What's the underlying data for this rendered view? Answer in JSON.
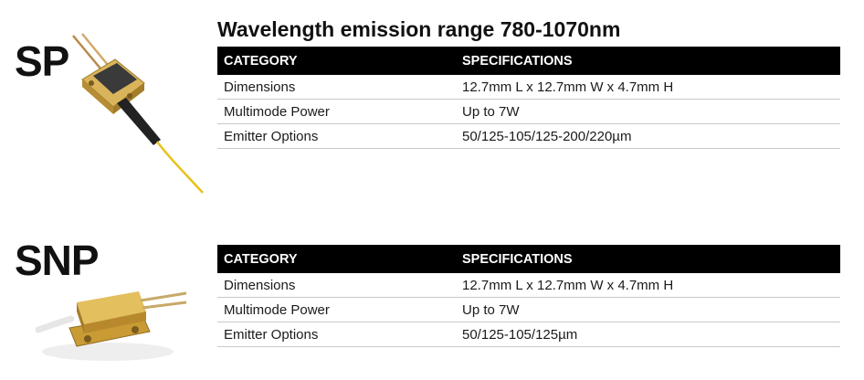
{
  "products": [
    {
      "label": "SP",
      "header": {
        "col1": "CATEGORY",
        "col2": "SPECIFICATIONS"
      },
      "rows": [
        {
          "category": "Dimensions",
          "spec": "12.7mm L x 12.7mm W x 4.7mm H"
        },
        {
          "category": "Multimode Power",
          "spec": "Up to 7W"
        },
        {
          "category": "Emitter Options",
          "spec": "50/125-105/125-200/220µm"
        }
      ]
    },
    {
      "label": "SNP",
      "header": {
        "col1": "CATEGORY",
        "col2": "SPECIFICATIONS"
      },
      "rows": [
        {
          "category": "Dimensions",
          "spec": "12.7mm L x 12.7mm W x 4.7mm H"
        },
        {
          "category": "Multimode Power",
          "spec": "Up to 7W"
        },
        {
          "category": "Emitter Options",
          "spec": "50/125-105/125µm"
        }
      ]
    }
  ],
  "section_title": "Wavelength emission range 780-1070nm",
  "colors": {
    "header_bg": "#000000",
    "header_text": "#ffffff",
    "gold": "#c9a23a",
    "fiber": "#e8c21a"
  }
}
